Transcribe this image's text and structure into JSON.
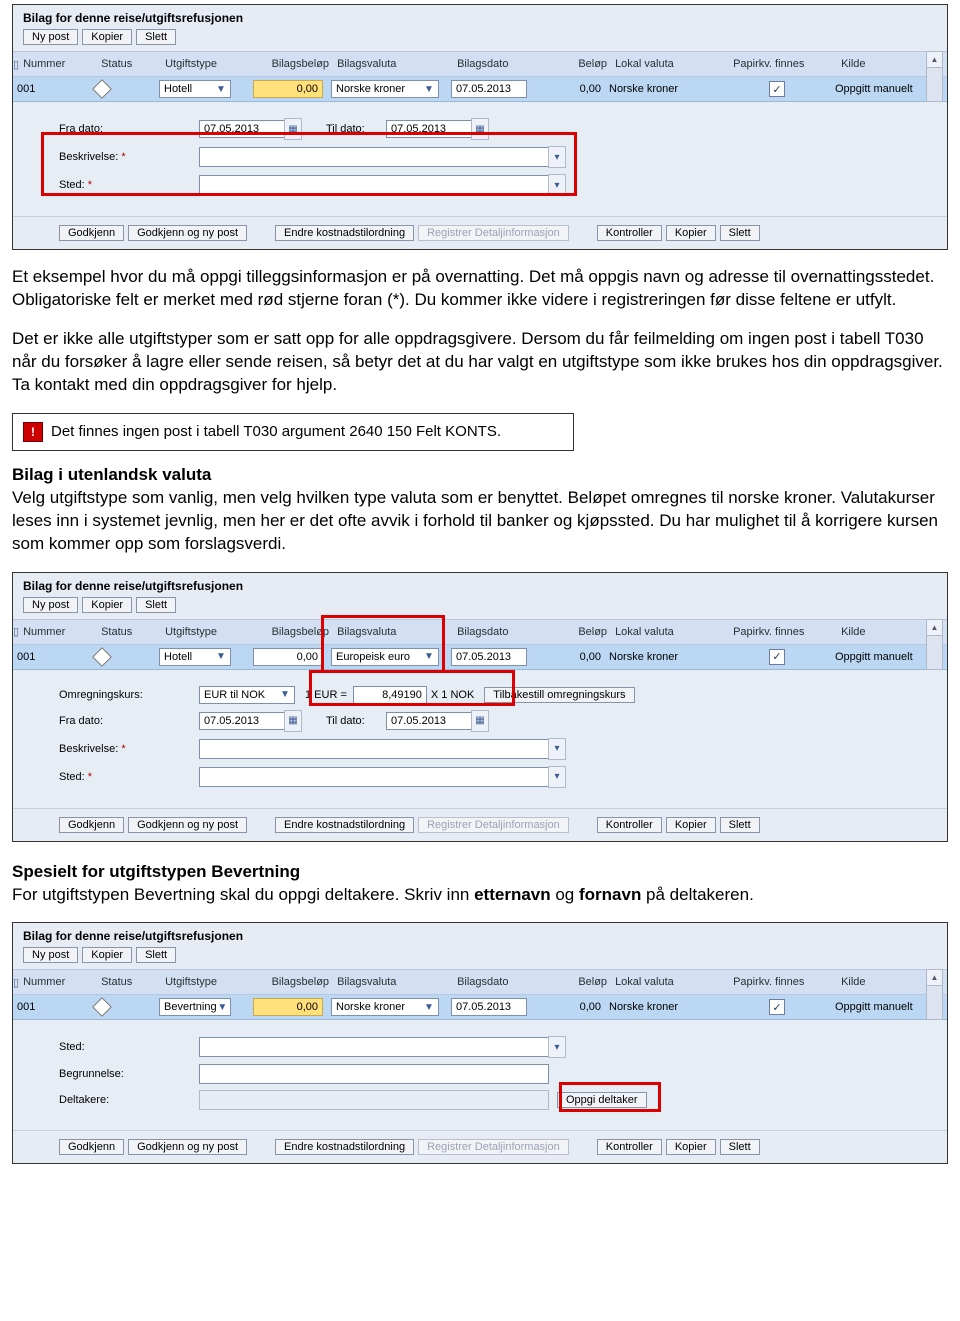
{
  "panel": {
    "title": "Bilag for denne reise/utgiftsrefusjonen",
    "toolbar": {
      "nypost": "Ny post",
      "kopier": "Kopier",
      "slett": "Slett"
    },
    "headers": {
      "nummer": "Nummer",
      "status": "Status",
      "utgiftstype": "Utgiftstype",
      "bilagsbelop": "Bilagsbeløp",
      "bilagsvaluta": "Bilagsvaluta",
      "bilagsdato": "Bilagsdato",
      "belop": "Beløp",
      "lokalvaluta": "Lokal valuta",
      "papirkv": "Papirkv. finnes",
      "kilde": "Kilde"
    },
    "row1": {
      "nummer": "001",
      "utgiftstype": "Hotell",
      "bilagsbelop": "0,00",
      "bilagsvaluta": "Norske kroner",
      "bilagsdato": "07.05.2013",
      "belop": "0,00",
      "lokalvaluta": "Norske kroner",
      "papirkv": "✓",
      "kilde": "Oppgitt manuelt"
    },
    "details": {
      "fra": "Fra dato:",
      "fra_val": "07.05.2013",
      "til": "Til dato:",
      "til_val": "07.05.2013",
      "beskrivelse": "Beskrivelse:",
      "sted": "Sted:"
    },
    "actions": {
      "godkjenn": "Godkjenn",
      "godkjenn_ny": "Godkjenn og ny post",
      "endre": "Endre kostnadstilordning",
      "registrer": "Registrer Detaljinformasjon",
      "kontroller": "Kontroller",
      "kopier": "Kopier",
      "slett": "Slett"
    }
  },
  "text1": "Et eksempel hvor du må oppgi tilleggsinformasjon er på overnatting. Det må oppgis navn og adresse til overnattingsstedet. Obligatoriske felt er merket med rød stjerne foran (*). Du kommer ikke videre i registreringen før disse feltene er utfylt.",
  "text2": "Det er ikke alle utgiftstyper som er satt opp for alle oppdragsgivere. Dersom du får feilmelding om ingen post i tabell T030 når du forsøker å lagre eller sende reisen, så betyr det at du har valgt en utgiftstype som ikke brukes hos din oppdragsgiver. Ta kontakt med din oppdragsgiver for hjelp.",
  "errmsg": "Det finnes ingen post i tabell T030 argument 2640 150 Felt KONTS.",
  "heading_valuta": "Bilag i utenlandsk valuta",
  "text3": "Velg utgiftstype som vanlig, men velg hvilken type valuta som er benyttet. Beløpet omregnes til norske kroner. Valutakurser leses inn i systemet jevnlig, men her er det ofte avvik i forhold til banker og kjøpssted. Du har mulighet til å korrigere kursen som kommer opp som forslagsverdi.",
  "panel2": {
    "row": {
      "nummer": "001",
      "utgiftstype": "Hotell",
      "bilagsbelop": "0,00",
      "bilagsvaluta": "Europeisk euro",
      "bilagsdato": "07.05.2013",
      "belop": "0,00",
      "lokalvaluta": "Norske kroner",
      "papirkv": "✓",
      "kilde": "Oppgitt manuelt"
    },
    "conv": {
      "label": "Omregningskurs:",
      "pair": "EUR til NOK",
      "prefix": "1 EUR =",
      "rate": "8,49190",
      "suffix": "X 1 NOK",
      "reset": "Tilbakestill omregningskurs"
    }
  },
  "heading_bev": "Spesielt for utgiftstypen Bevertning",
  "text4_a": "For utgiftstypen Bevertning skal du oppgi deltakere. Skriv inn ",
  "text4_b": "etternavn",
  "text4_c": " og ",
  "text4_d": "fornavn",
  "text4_e": " på deltakeren.",
  "panel3": {
    "row": {
      "nummer": "001",
      "utgiftstype": "Bevertning",
      "bilagsbelop": "0,00",
      "bilagsvaluta": "Norske kroner",
      "bilagsdato": "07.05.2013",
      "belop": "0,00",
      "lokalvaluta": "Norske kroner",
      "papirkv": "✓",
      "kilde": "Oppgitt manuelt"
    },
    "details": {
      "sted": "Sted:",
      "begrunnelse": "Begrunnelse:",
      "deltakere": "Deltakere:",
      "oppgi": "Oppgi deltaker"
    }
  }
}
